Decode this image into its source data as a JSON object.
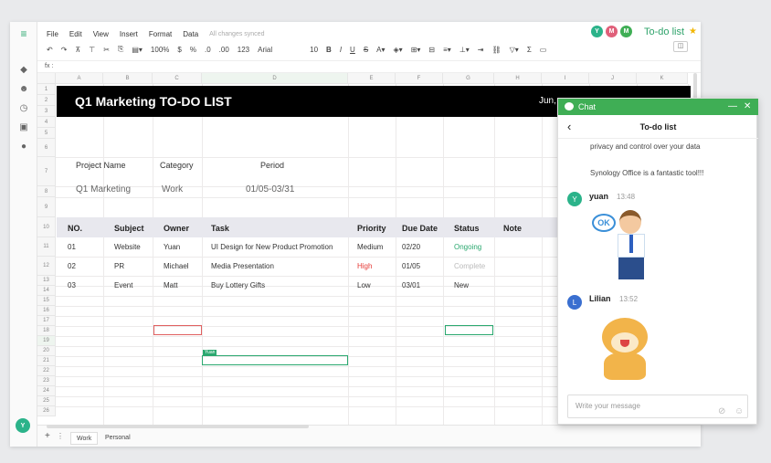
{
  "menu": [
    "File",
    "Edit",
    "View",
    "Insert",
    "Format",
    "Data"
  ],
  "sync_status": "All changes synced",
  "toolbar": {
    "zoom": "100%",
    "currency": "$",
    "percent": "%",
    "decimals_less": ".0",
    "decimals_more": ".00",
    "number_format": "123",
    "font": "Arial",
    "font_size": "10",
    "bold": "B",
    "italic": "I",
    "underline": "U",
    "strike": "S",
    "sum": "Σ"
  },
  "fx_label": "fx",
  "doc_title": "To-do list",
  "collaborators": [
    {
      "initial": "Y",
      "color": "#2bb38a"
    },
    {
      "initial": "M",
      "color": "#e0607a"
    },
    {
      "initial": "M",
      "color": "#3fae55"
    }
  ],
  "columns": [
    "A",
    "B",
    "C",
    "D",
    "E",
    "F",
    "G",
    "H",
    "I",
    "J",
    "K"
  ],
  "rows": [
    "1",
    "2",
    "3",
    "4",
    "5",
    "6",
    "7",
    "8",
    "9",
    "10",
    "11",
    "12",
    "13",
    "14",
    "15",
    "16",
    "17",
    "18",
    "19",
    "20",
    "21",
    "22",
    "23",
    "24",
    "25",
    "26"
  ],
  "banner": {
    "title": "Q1 Marketing TO-DO LIST",
    "date": "Jun,"
  },
  "info": {
    "project_label": "Project Name",
    "category_label": "Category",
    "period_label": "Period",
    "project_value": "Q1 Marketing",
    "category_value": "Work",
    "period_value": "01/05-03/31"
  },
  "table": {
    "headers": [
      "NO.",
      "Subject",
      "Owner",
      "Task",
      "Priority",
      "Due Date",
      "Status",
      "Note"
    ],
    "rows": [
      {
        "no": "01",
        "subject": "Website",
        "owner": "Yuan",
        "task": "UI Design for New Product Promotion",
        "priority": "Medium",
        "due": "02/20",
        "status": "Ongoing"
      },
      {
        "no": "02",
        "subject": "PR",
        "owner": "Michael",
        "task": "Media Presentation",
        "priority": "High",
        "due": "01/05",
        "status": "Complete"
      },
      {
        "no": "03",
        "subject": "Event",
        "owner": "Matt",
        "task": "Buy Lottery Gifts",
        "priority": "Low",
        "due": "03/01",
        "status": "New"
      }
    ]
  },
  "cursor_tag": "Yuan",
  "sheets": [
    "Work",
    "Personal"
  ],
  "user_initial": "Y",
  "chat": {
    "header": "Chat",
    "title": "To-do list",
    "lines": [
      "privacy and control over your data",
      "Synology Office is a fantastic tool!!!"
    ],
    "messages": [
      {
        "initial": "Y",
        "name": "yuan",
        "time": "13:48",
        "sticker": "OK"
      },
      {
        "initial": "L",
        "name": "Lilian",
        "time": "13:52"
      }
    ],
    "input_placeholder": "Write your message"
  },
  "colors": {
    "accent": "#3fae55",
    "high": "#e53935",
    "ongoing": "#2aa86f"
  }
}
